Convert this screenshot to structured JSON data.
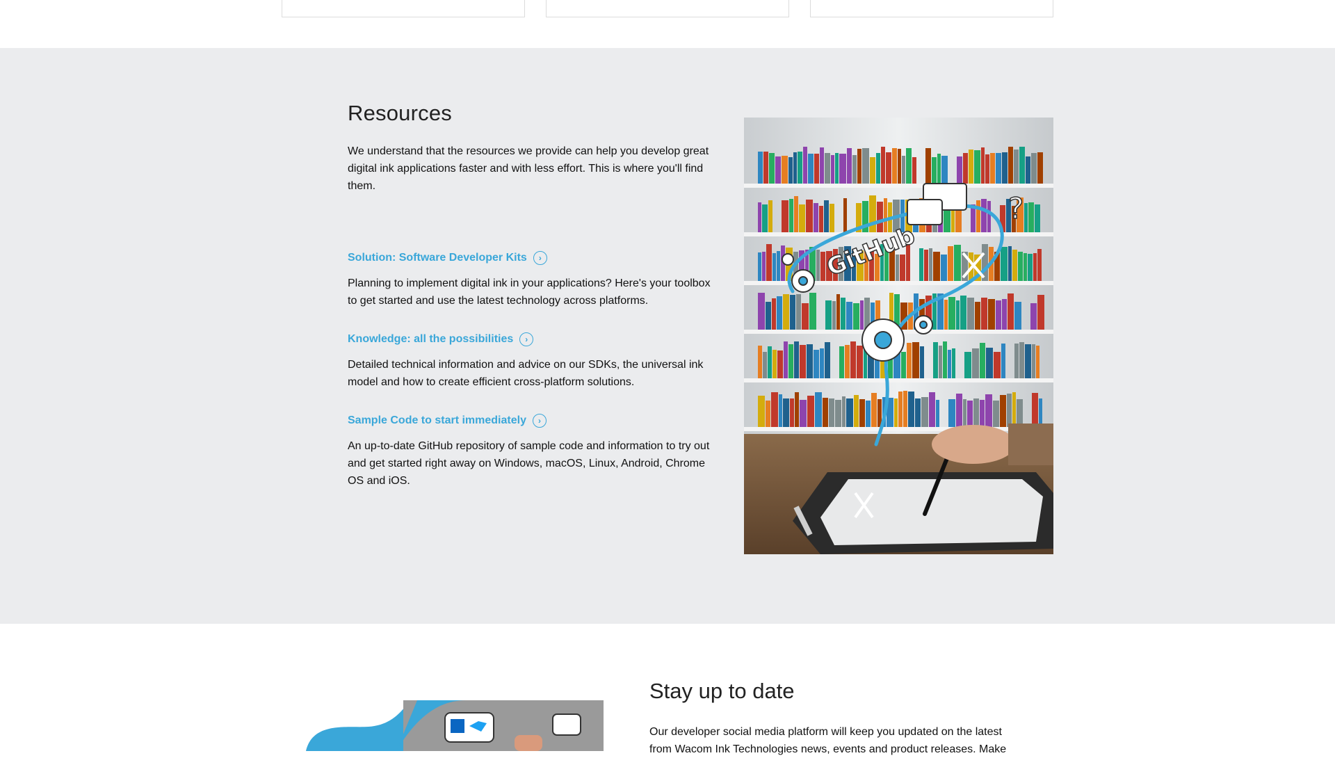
{
  "resources": {
    "title": "Resources",
    "intro": "We understand that the resources we provide can help you develop great digital ink applications faster and with less effort. This is where you'll find them.",
    "items": [
      {
        "link": "Solution: Software Developer Kits",
        "desc": "Planning to implement digital ink in your applications? Here's your toolbox to get started and use the latest technology across platforms."
      },
      {
        "link": "Knowledge: all the possibilities",
        "desc": "Detailed technical information and advice on our SDKs, the universal ink model and how to create efficient cross-platform solutions."
      },
      {
        "link": "Sample Code to start immediately",
        "desc": "An up-to-date GitHub repository of sample code and information to try out and get started right away on Windows, macOS, Linux, Android, Chrome OS and iOS."
      }
    ],
    "image": {
      "label": "GitHub",
      "accent": "#3aa7d9"
    }
  },
  "stay": {
    "title": "Stay up to date",
    "text": "Our developer social media platform will keep you updated on the latest from Wacom Ink Technologies news, events and product releases. Make"
  },
  "colors": {
    "accent": "#3aa7d9",
    "section_bg": "#ebecee"
  },
  "icons": {
    "link_arrow": "chevron-right-circle-icon"
  }
}
